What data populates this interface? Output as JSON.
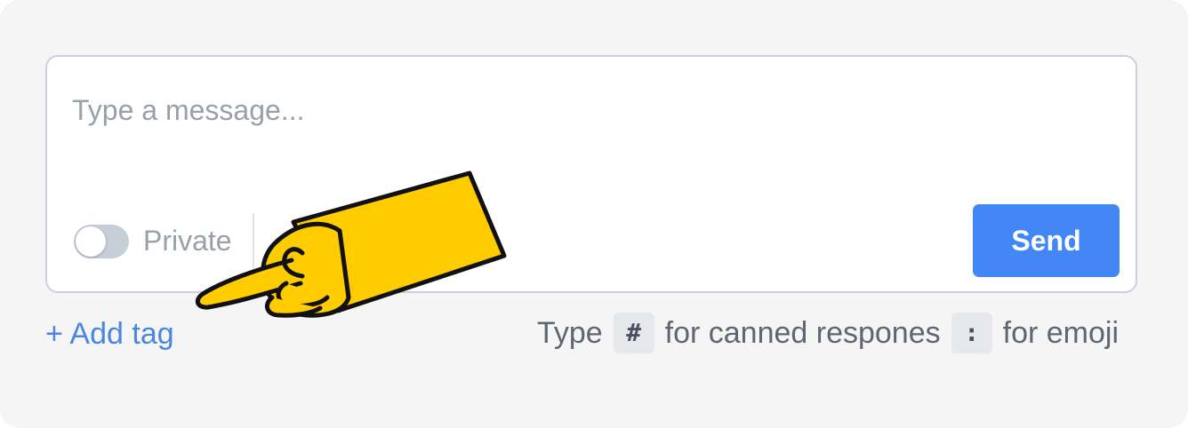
{
  "composer": {
    "placeholder": "Type a message...",
    "private_label": "Private",
    "private_enabled": false,
    "send_label": "Send"
  },
  "footer": {
    "add_tag_label": "+ Add tag",
    "hint_prefix": "Type",
    "hint_hash_key": "#",
    "hint_middle": "for canned respones",
    "hint_colon_key": ":",
    "hint_suffix": "for emoji"
  },
  "colors": {
    "accent": "#4287f5",
    "link": "#4a86e0",
    "hand_fill": "#ffcc00"
  },
  "icons": {
    "annotation": "pointing-hand-icon"
  }
}
